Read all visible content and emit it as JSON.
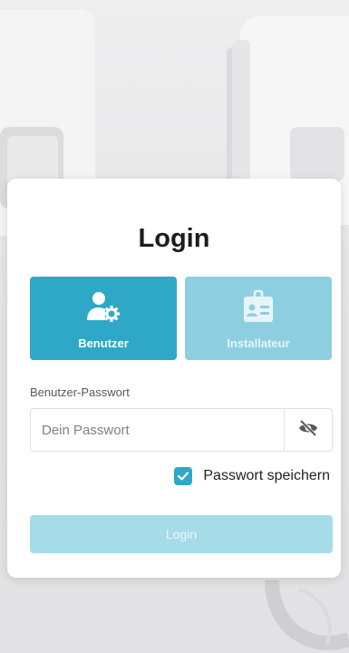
{
  "login": {
    "title": "Login",
    "roles": [
      {
        "label": "Benutzer",
        "icon": "user-gear-icon",
        "selected": true
      },
      {
        "label": "Installateur",
        "icon": "id-badge-icon",
        "selected": false
      }
    ],
    "password": {
      "label": "Benutzer-Passwort",
      "placeholder": "Dein Passwort",
      "value": "",
      "toggle_icon": "eye-slash-icon"
    },
    "remember": {
      "label": "Passwort speichern",
      "checked": true
    },
    "submit_label": "Login"
  },
  "colors": {
    "primary": "#2ea8c6",
    "primary_light": "#8dcfe1",
    "submit_disabled": "#a6dbe8"
  }
}
